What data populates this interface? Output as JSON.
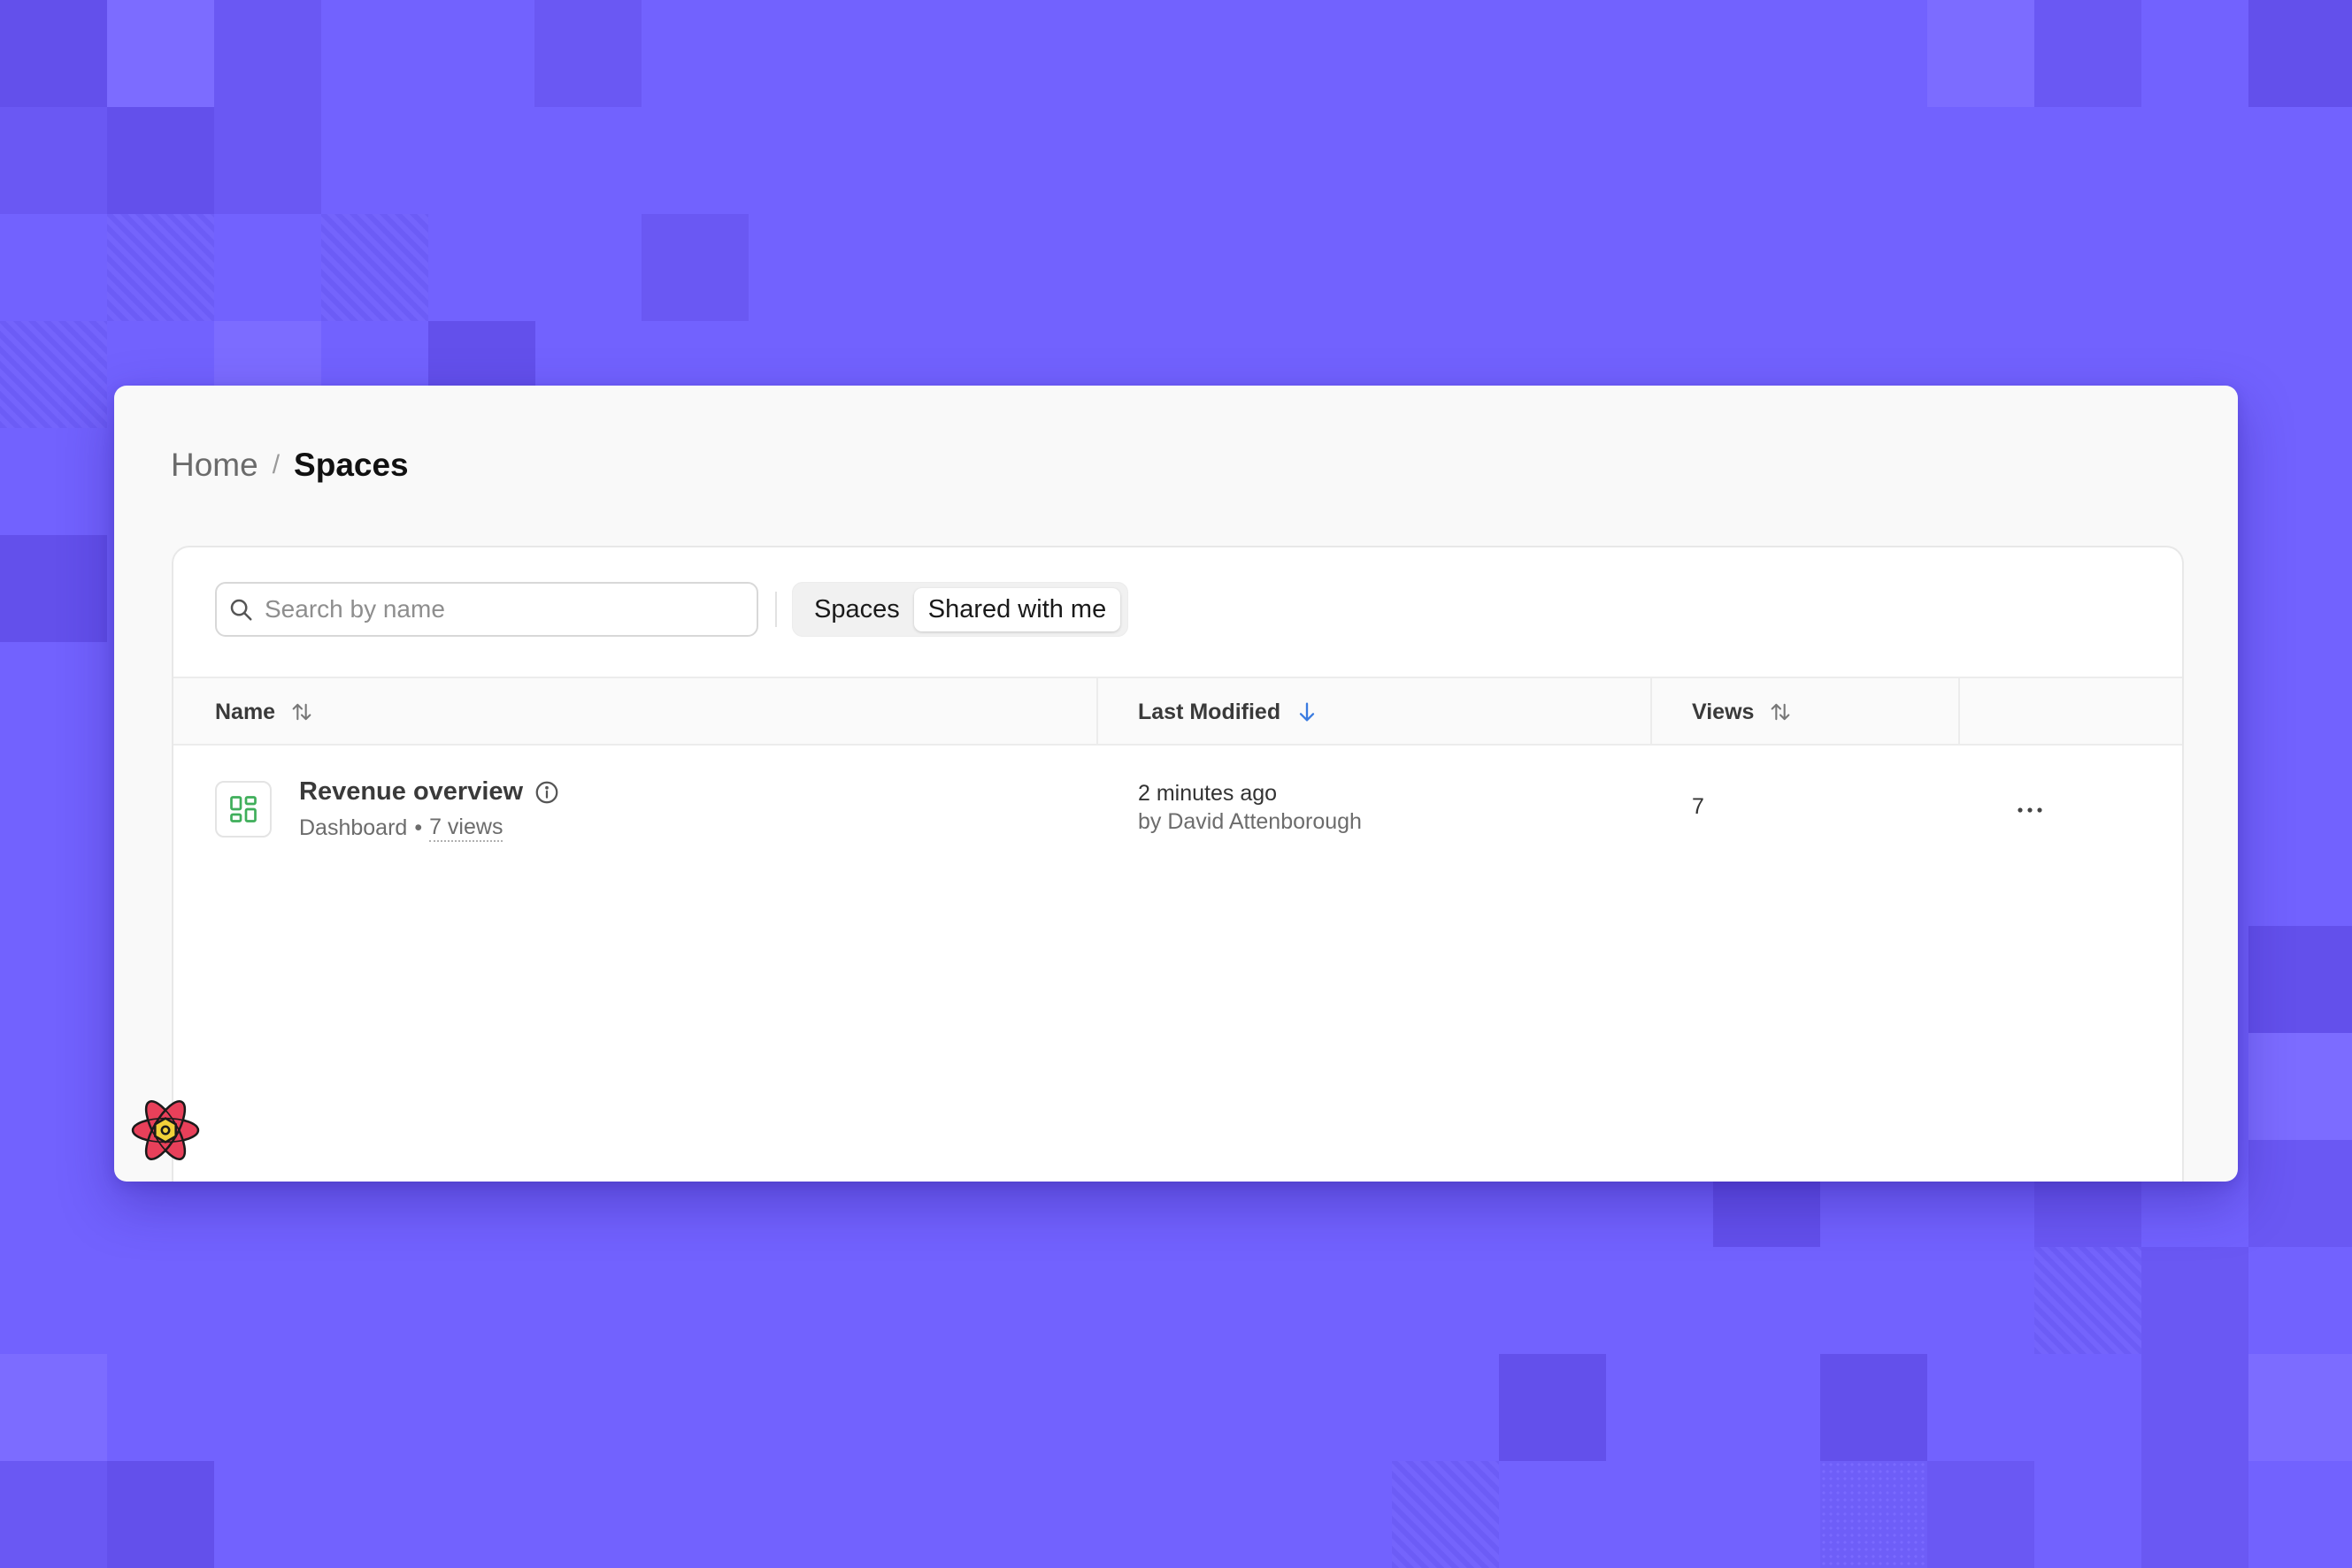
{
  "breadcrumb": {
    "home": "Home",
    "separator": "/",
    "current": "Spaces"
  },
  "toolbar": {
    "search_placeholder": "Search by name",
    "search_value": "",
    "tabs": [
      {
        "label": "Spaces",
        "active": false
      },
      {
        "label": "Shared with me",
        "active": true
      }
    ]
  },
  "table": {
    "columns": [
      {
        "label": "Name",
        "sort": "none"
      },
      {
        "label": "Last Modified",
        "sort": "desc"
      },
      {
        "label": "Views",
        "sort": "none"
      }
    ],
    "rows": [
      {
        "title": "Revenue overview",
        "type": "Dashboard",
        "separator": "•",
        "views_label": "7 views",
        "modified": "2 minutes ago",
        "modified_by": "by David Attenborough",
        "views": "7"
      }
    ]
  },
  "colors": {
    "background": "#7262fe",
    "accent_sort": "#3a7be0",
    "dashboard_icon": "#3fae5a",
    "react_logo": "#e8405a"
  },
  "icons": {
    "search": "search-icon",
    "sort": "sort-icon",
    "sort_desc": "arrow-down-icon",
    "dashboard": "dashboard-icon",
    "info": "info-icon",
    "more": "more-horizontal-icon",
    "devtools": "react-logo-icon"
  }
}
